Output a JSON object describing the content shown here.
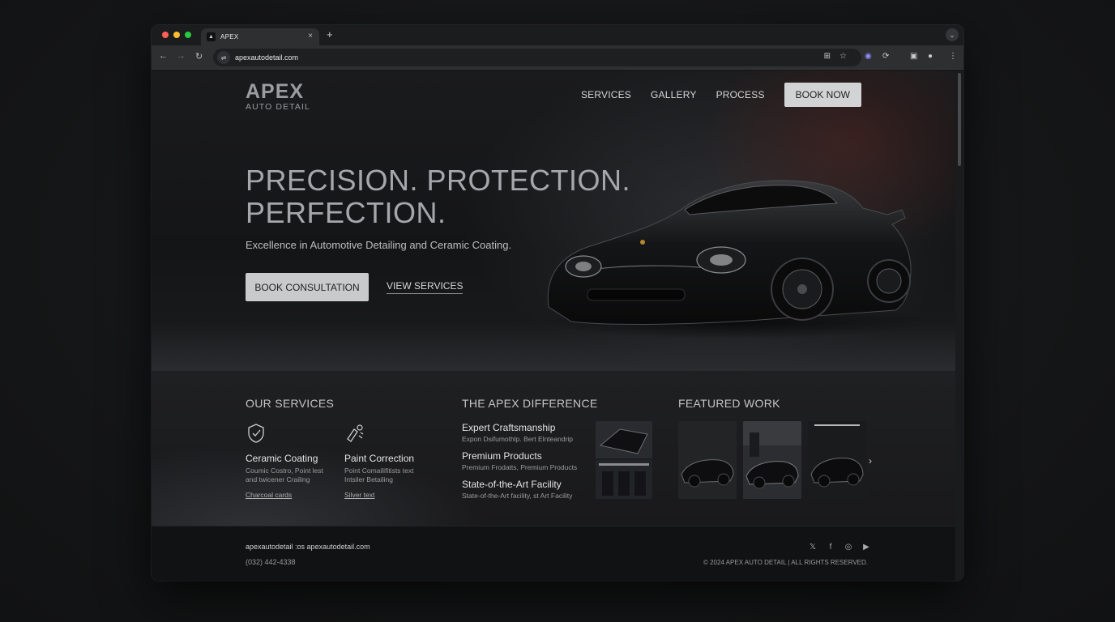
{
  "browser": {
    "tab_title": "APEX",
    "tab_close": "×",
    "new_tab": "+",
    "url": "apexautodetail.com",
    "traffic_lights": [
      "#ff5f57",
      "#febc2e",
      "#28c840"
    ]
  },
  "site": {
    "logo_main": "APEX",
    "logo_sub": "AUTO DETAIL",
    "nav": [
      "SERVICES",
      "GALLERY",
      "PROCESS"
    ],
    "nav_cta": "BOOK NOW",
    "headline_line1": "PRECISION. PROTECTION.",
    "headline_line2": "PERFECTION.",
    "tagline": "Excellence in Automotive Detailing and Ceramic Coating.",
    "cta_primary": "BOOK CONSULTATION",
    "cta_secondary": "VIEW SERVICES"
  },
  "services": {
    "title": "OUR SERVICES",
    "items": [
      {
        "name": "Ceramic Coating",
        "desc_line1": "Coumic Costro, Point lest",
        "desc_line2": "and twicener Crailing",
        "link": "Charcoal cards",
        "icon": "shield-icon"
      },
      {
        "name": "Paint Correction",
        "desc_line1": "Point Comailifitists text",
        "desc_line2": "Intsiler Betailing",
        "link": "Silver text",
        "icon": "polish-icon"
      }
    ]
  },
  "difference": {
    "title": "THE APEX DIFFERENCE",
    "items": [
      {
        "name": "Expert Craftsmanship",
        "sub": "Expon Dsifumothlp. Bert Elnteandrip"
      },
      {
        "name": "Premium Products",
        "sub": "Premium Frodatts, Premium Products"
      },
      {
        "name": "State-of-the-Art Facility",
        "sub": "State-of-the-Art facility, st Art Facility"
      }
    ]
  },
  "featured": {
    "title": "FEATURED WORK",
    "next": "›"
  },
  "footer": {
    "email": "apexautodetail :os apexautodetail.com",
    "phone": "(032) 442-4338",
    "social": [
      "twitter-icon",
      "facebook-icon",
      "instagram-icon",
      "youtube-icon"
    ],
    "copyright": "© 2024 APEX AUTO DETAIL | ALL RIGHTS RESERVED."
  }
}
